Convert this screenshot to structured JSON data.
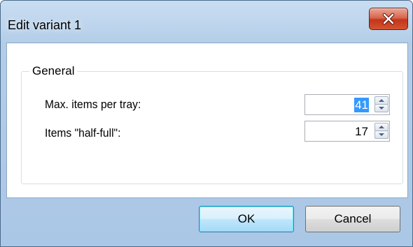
{
  "window": {
    "title": "Edit variant 1",
    "close_icon": "close-icon"
  },
  "group": {
    "legend": "General"
  },
  "fields": [
    {
      "label": "Max. items per tray:",
      "value": "41",
      "selected": true
    },
    {
      "label": "Items \"half-full\":",
      "value": "17",
      "selected": false
    }
  ],
  "buttons": {
    "ok": "OK",
    "cancel": "Cancel"
  },
  "colors": {
    "selection": "#3399ff",
    "close_button": "#c2361b"
  }
}
